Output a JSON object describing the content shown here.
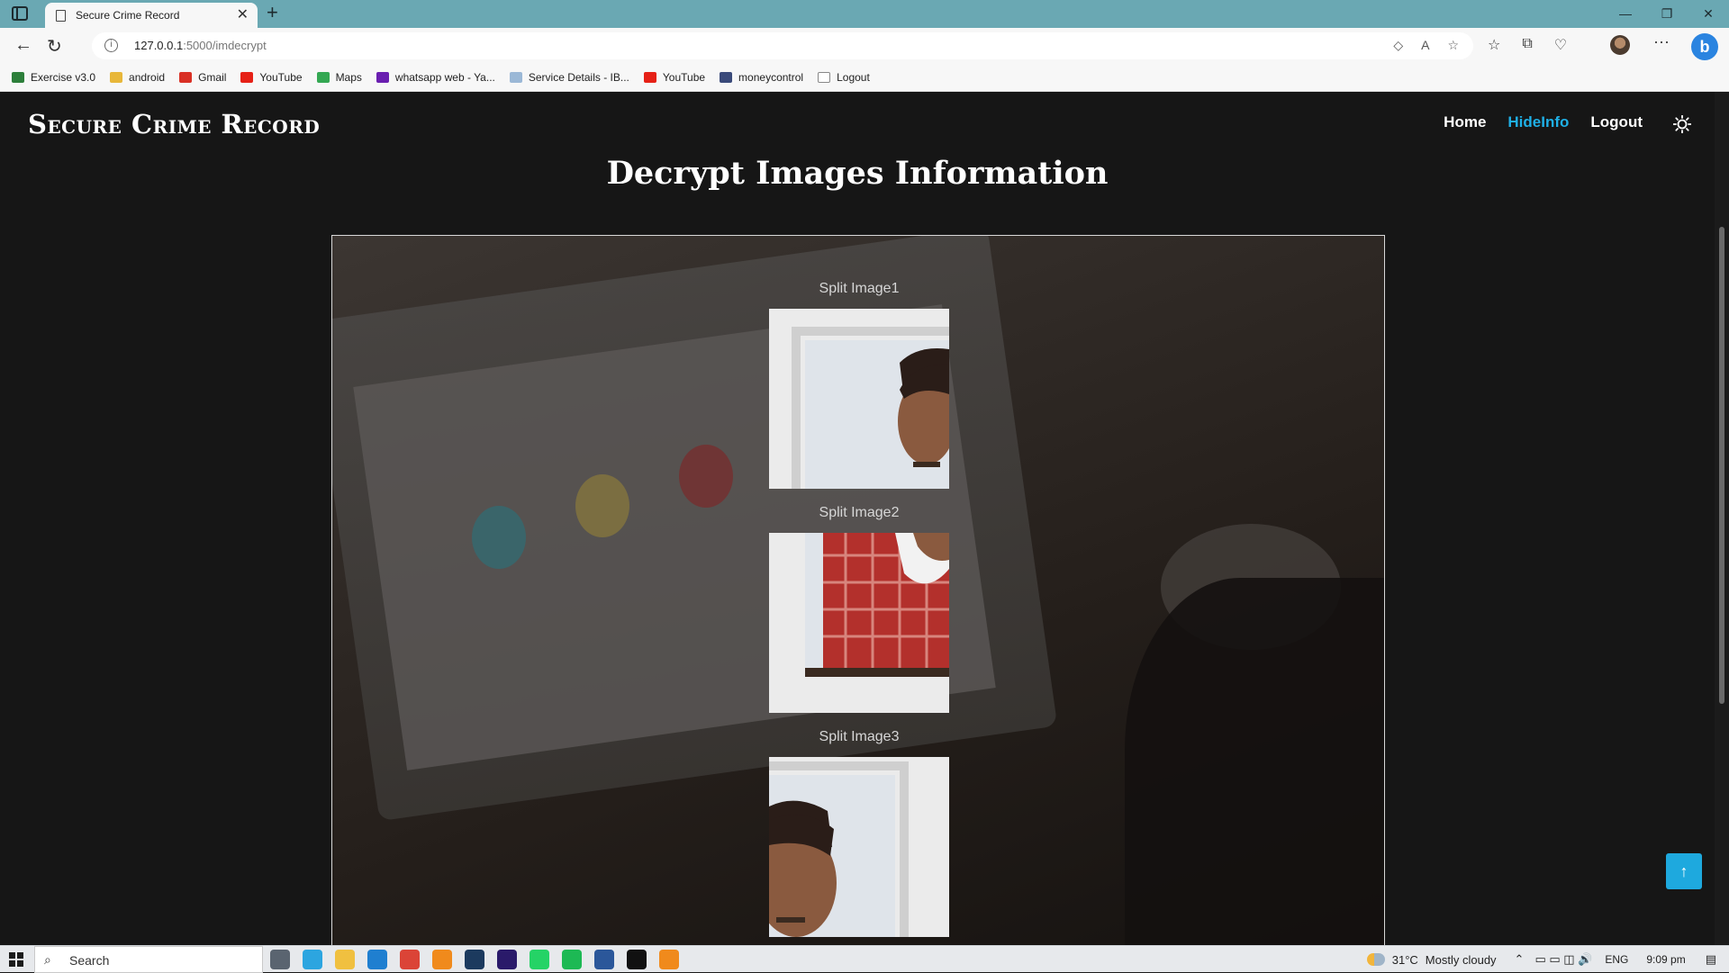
{
  "browser": {
    "tab_title": "Secure Crime Record",
    "url_host": "127.0.0.1",
    "url_path": ":5000/imdecrypt",
    "bookmarks": [
      {
        "label": "Exercise v3.0",
        "color": "#2d7f3b"
      },
      {
        "label": "android",
        "color": "#e8b73a"
      },
      {
        "label": "Gmail",
        "color": "#d93025"
      },
      {
        "label": "YouTube",
        "color": "#e62117"
      },
      {
        "label": "Maps",
        "color": "#34a853"
      },
      {
        "label": "whatsapp web - Ya...",
        "color": "#6a1fb0"
      },
      {
        "label": "Service Details - IB...",
        "color": "#9bb8d6"
      },
      {
        "label": "YouTube",
        "color": "#e62117"
      },
      {
        "label": "moneycontrol",
        "color": "#3a4a7a"
      },
      {
        "label": "Logout",
        "color": "#888888"
      }
    ]
  },
  "site": {
    "brand": "Secure Crime Record",
    "nav": {
      "home": "Home",
      "hideinfo": "HideInfo",
      "logout": "Logout"
    },
    "accent_color": "#1fb0e6"
  },
  "main": {
    "title": "Decrypt Images Information",
    "splits": [
      {
        "label": "Split Image1"
      },
      {
        "label": "Split Image2"
      },
      {
        "label": "Split Image3"
      }
    ]
  },
  "taskbar": {
    "search_text": "Search",
    "temperature": "31°C",
    "weather": "Mostly cloudy",
    "language": "ENG",
    "time": "9:09 pm"
  }
}
